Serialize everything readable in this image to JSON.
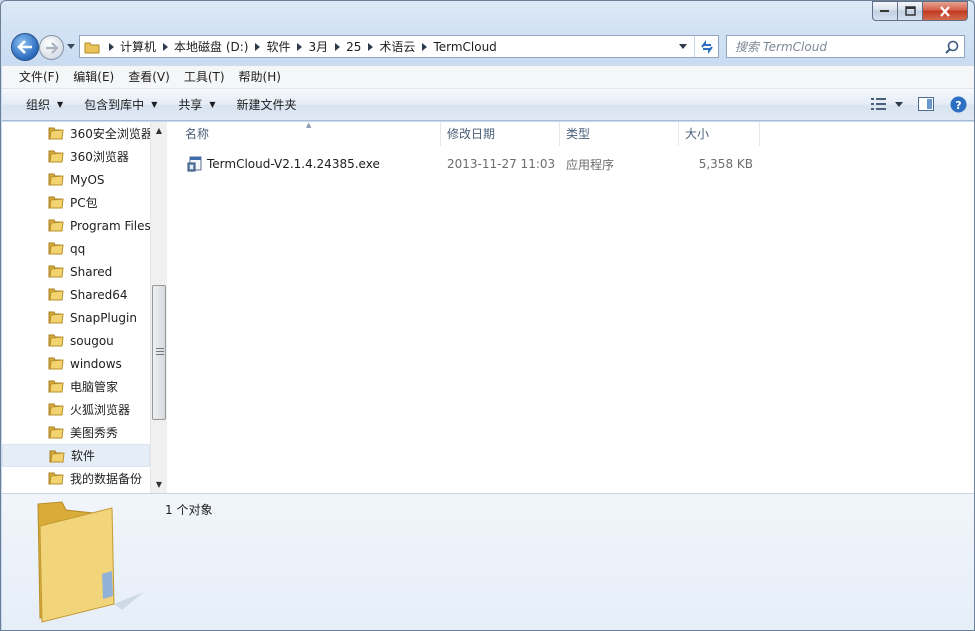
{
  "window": {
    "minimize_icon": "minimize-icon",
    "maximize_icon": "maximize-icon",
    "close_icon": "close-icon"
  },
  "nav": {
    "back_icon": "back-arrow-icon",
    "forward_icon": "forward-arrow-icon",
    "breadcrumb": [
      "计算机",
      "本地磁盘 (D:)",
      "软件",
      "3月",
      "25",
      "术语云",
      "TermCloud"
    ],
    "search_placeholder": "搜索 TermCloud"
  },
  "menu": [
    "文件(F)",
    "编辑(E)",
    "查看(V)",
    "工具(T)",
    "帮助(H)"
  ],
  "commands": {
    "organize": "组织",
    "include_in_library": "包含到库中",
    "share": "共享",
    "new_folder": "新建文件夹"
  },
  "tree": [
    {
      "label": "360安全浏览器",
      "selected": false
    },
    {
      "label": "360浏览器",
      "selected": false
    },
    {
      "label": "MyOS",
      "selected": false
    },
    {
      "label": "PC包",
      "selected": false
    },
    {
      "label": "Program Files",
      "selected": false
    },
    {
      "label": "qq",
      "selected": false
    },
    {
      "label": "Shared",
      "selected": false
    },
    {
      "label": "Shared64",
      "selected": false
    },
    {
      "label": "SnapPlugin",
      "selected": false
    },
    {
      "label": "sougou",
      "selected": false
    },
    {
      "label": "windows",
      "selected": false
    },
    {
      "label": "电脑管家",
      "selected": false
    },
    {
      "label": "火狐浏览器",
      "selected": false
    },
    {
      "label": "美图秀秀",
      "selected": false
    },
    {
      "label": "软件",
      "selected": true
    },
    {
      "label": "我的数据备份",
      "selected": false
    }
  ],
  "columns": {
    "name": "名称",
    "modified": "修改日期",
    "type": "类型",
    "size": "大小"
  },
  "files": [
    {
      "name": "TermCloud-V2.1.4.24385.exe",
      "modified": "2013-11-27 11:03",
      "type": "应用程序",
      "size": "5,358 KB",
      "icon": "exe-file-icon"
    }
  ],
  "details": {
    "count": "1 个对象"
  },
  "colors": {
    "chrome": "#c3d7ee",
    "selection": "#e5edf6",
    "header_text": "#4c607a"
  }
}
